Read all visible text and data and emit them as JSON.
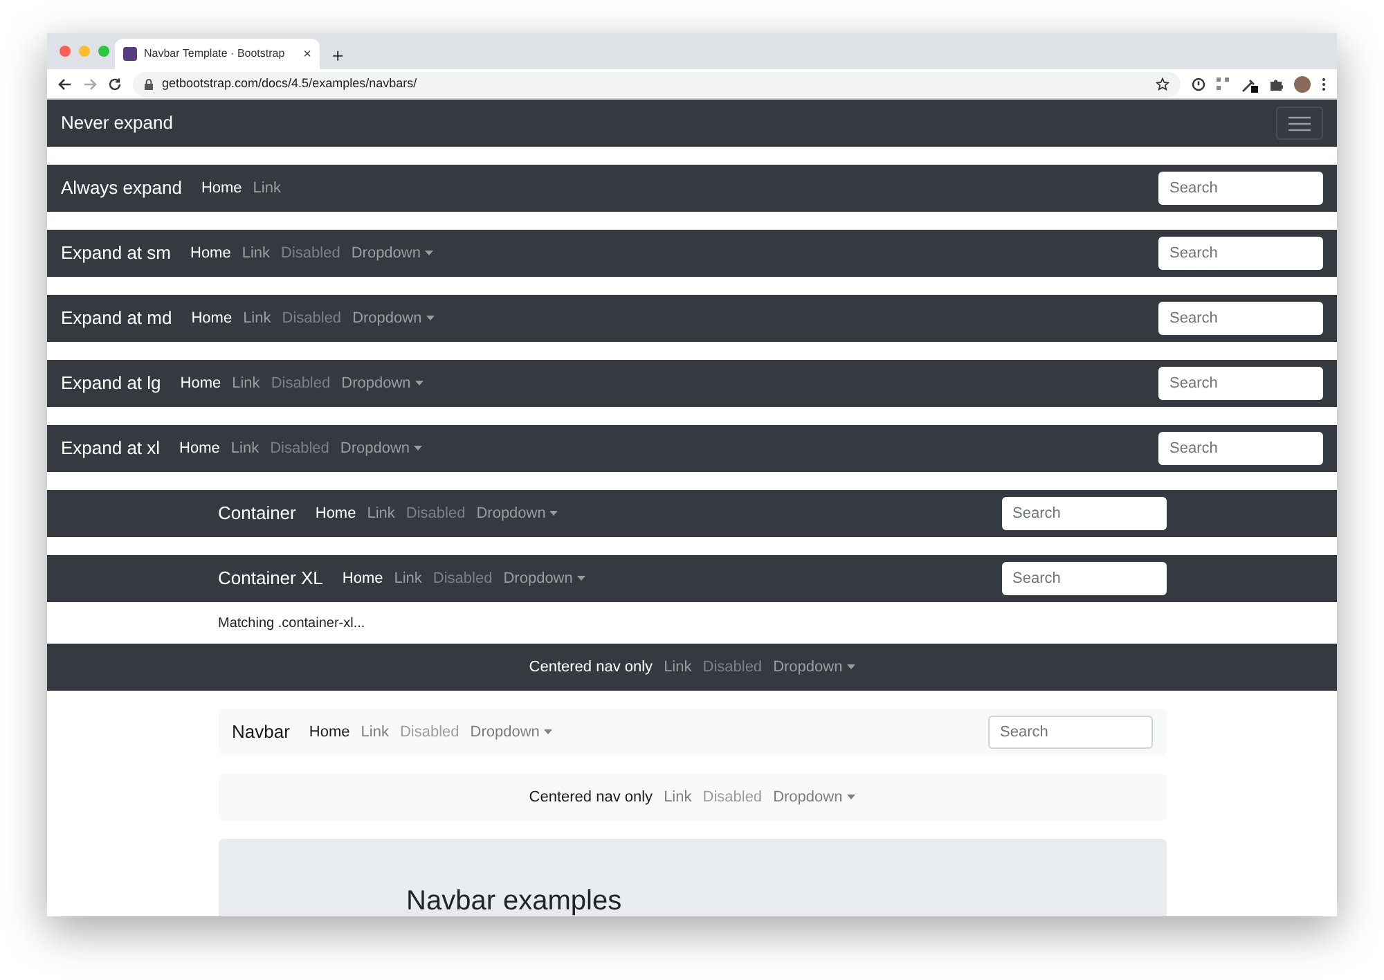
{
  "browser": {
    "tab_title": "Navbar Template · Bootstrap",
    "tab_close": "×",
    "new_tab": "+",
    "url": "getbootstrap.com/docs/4.5/examples/navbars/"
  },
  "navbars": [
    {
      "kind": "dark",
      "contained": false,
      "centered": false,
      "brand": "Never expand",
      "toggler": true
    },
    {
      "kind": "dark",
      "contained": false,
      "centered": false,
      "brand": "Always expand",
      "search": {
        "placeholder": "Search"
      },
      "items": [
        {
          "label": "Home",
          "active": true,
          "disabled": false,
          "dropdown": false
        },
        {
          "label": "Link",
          "active": false,
          "disabled": false,
          "dropdown": false
        }
      ]
    },
    {
      "kind": "dark",
      "contained": false,
      "centered": false,
      "brand": "Expand at sm",
      "search": {
        "placeholder": "Search"
      },
      "items": [
        {
          "label": "Home",
          "active": true,
          "disabled": false,
          "dropdown": false
        },
        {
          "label": "Link",
          "active": false,
          "disabled": false,
          "dropdown": false
        },
        {
          "label": "Disabled",
          "active": false,
          "disabled": true,
          "dropdown": false
        },
        {
          "label": "Dropdown",
          "active": false,
          "disabled": false,
          "dropdown": true
        }
      ]
    },
    {
      "kind": "dark",
      "contained": false,
      "centered": false,
      "brand": "Expand at md",
      "search": {
        "placeholder": "Search"
      },
      "items": [
        {
          "label": "Home",
          "active": true,
          "disabled": false,
          "dropdown": false
        },
        {
          "label": "Link",
          "active": false,
          "disabled": false,
          "dropdown": false
        },
        {
          "label": "Disabled",
          "active": false,
          "disabled": true,
          "dropdown": false
        },
        {
          "label": "Dropdown",
          "active": false,
          "disabled": false,
          "dropdown": true
        }
      ]
    },
    {
      "kind": "dark",
      "contained": false,
      "centered": false,
      "brand": "Expand at lg",
      "search": {
        "placeholder": "Search"
      },
      "items": [
        {
          "label": "Home",
          "active": true,
          "disabled": false,
          "dropdown": false
        },
        {
          "label": "Link",
          "active": false,
          "disabled": false,
          "dropdown": false
        },
        {
          "label": "Disabled",
          "active": false,
          "disabled": true,
          "dropdown": false
        },
        {
          "label": "Dropdown",
          "active": false,
          "disabled": false,
          "dropdown": true
        }
      ]
    },
    {
      "kind": "dark",
      "contained": false,
      "centered": false,
      "brand": "Expand at xl",
      "search": {
        "placeholder": "Search"
      },
      "items": [
        {
          "label": "Home",
          "active": true,
          "disabled": false,
          "dropdown": false
        },
        {
          "label": "Link",
          "active": false,
          "disabled": false,
          "dropdown": false
        },
        {
          "label": "Disabled",
          "active": false,
          "disabled": true,
          "dropdown": false
        },
        {
          "label": "Dropdown",
          "active": false,
          "disabled": false,
          "dropdown": true
        }
      ]
    },
    {
      "kind": "dark",
      "contained": true,
      "centered": false,
      "brand": "Container",
      "search": {
        "placeholder": "Search"
      },
      "items": [
        {
          "label": "Home",
          "active": true,
          "disabled": false,
          "dropdown": false
        },
        {
          "label": "Link",
          "active": false,
          "disabled": false,
          "dropdown": false
        },
        {
          "label": "Disabled",
          "active": false,
          "disabled": true,
          "dropdown": false
        },
        {
          "label": "Dropdown",
          "active": false,
          "disabled": false,
          "dropdown": true
        }
      ]
    },
    {
      "kind": "dark",
      "contained": true,
      "centered": false,
      "brand": "Container XL",
      "search": {
        "placeholder": "Search"
      },
      "note": "Matching .container-xl...",
      "items": [
        {
          "label": "Home",
          "active": true,
          "disabled": false,
          "dropdown": false
        },
        {
          "label": "Link",
          "active": false,
          "disabled": false,
          "dropdown": false
        },
        {
          "label": "Disabled",
          "active": false,
          "disabled": true,
          "dropdown": false
        },
        {
          "label": "Dropdown",
          "active": false,
          "disabled": false,
          "dropdown": true
        }
      ]
    },
    {
      "kind": "dark",
      "contained": true,
      "centered": true,
      "items": [
        {
          "label": "Centered nav only",
          "active": true,
          "disabled": false,
          "dropdown": false
        },
        {
          "label": "Link",
          "active": false,
          "disabled": false,
          "dropdown": false
        },
        {
          "label": "Disabled",
          "active": false,
          "disabled": true,
          "dropdown": false
        },
        {
          "label": "Dropdown",
          "active": false,
          "disabled": false,
          "dropdown": true
        }
      ]
    },
    {
      "kind": "light",
      "contained": true,
      "centered": false,
      "brand": "Navbar",
      "search": {
        "placeholder": "Search"
      },
      "items": [
        {
          "label": "Home",
          "active": true,
          "disabled": false,
          "dropdown": false
        },
        {
          "label": "Link",
          "active": false,
          "disabled": false,
          "dropdown": false
        },
        {
          "label": "Disabled",
          "active": false,
          "disabled": true,
          "dropdown": false
        },
        {
          "label": "Dropdown",
          "active": false,
          "disabled": false,
          "dropdown": true
        }
      ]
    },
    {
      "kind": "light",
      "contained": true,
      "centered": true,
      "items": [
        {
          "label": "Centered nav only",
          "active": true,
          "disabled": false,
          "dropdown": false
        },
        {
          "label": "Link",
          "active": false,
          "disabled": false,
          "dropdown": false
        },
        {
          "label": "Disabled",
          "active": false,
          "disabled": true,
          "dropdown": false
        },
        {
          "label": "Dropdown",
          "active": false,
          "disabled": false,
          "dropdown": true
        }
      ]
    }
  ],
  "jumbotron": {
    "heading": "Navbar examples"
  }
}
